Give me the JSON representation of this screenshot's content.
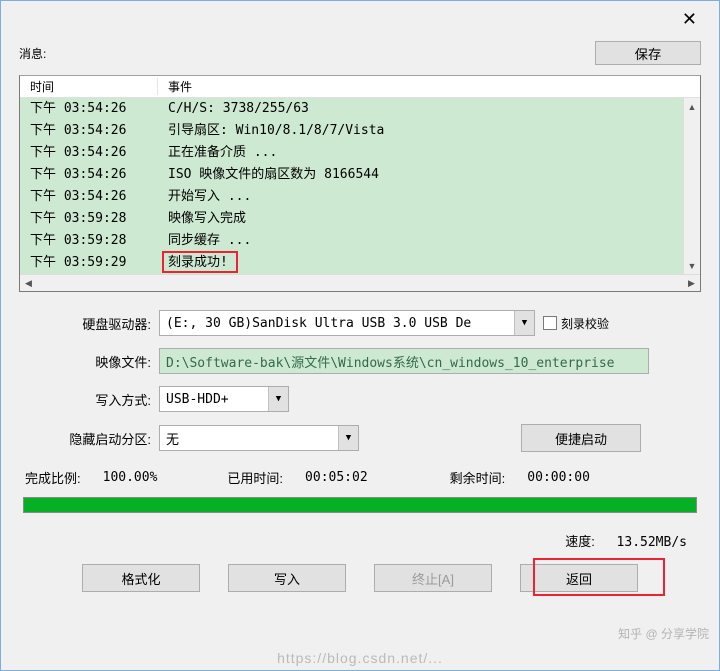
{
  "titlebar": {
    "close": "✕"
  },
  "top": {
    "message_label": "消息:",
    "save_label": "保存"
  },
  "log": {
    "header_time": "时间",
    "header_event": "事件",
    "rows": [
      {
        "time": "下午 03:54:26",
        "event": "C/H/S: 3738/255/63"
      },
      {
        "time": "下午 03:54:26",
        "event": "引导扇区: Win10/8.1/8/7/Vista"
      },
      {
        "time": "下午 03:54:26",
        "event": "正在准备介质 ..."
      },
      {
        "time": "下午 03:54:26",
        "event": "ISO 映像文件的扇区数为 8166544"
      },
      {
        "time": "下午 03:54:26",
        "event": "开始写入 ..."
      },
      {
        "time": "下午 03:59:28",
        "event": "映像写入完成"
      },
      {
        "time": "下午 03:59:28",
        "event": "同步缓存 ..."
      },
      {
        "time": "下午 03:59:29",
        "event": "刻录成功!"
      }
    ]
  },
  "form": {
    "drive_label": "硬盘驱动器:",
    "drive_value": "(E:, 30 GB)SanDisk Ultra USB 3.0 USB De",
    "verify_label": "刻录校验",
    "image_label": "映像文件:",
    "image_value": "D:\\Software-bak\\源文件\\Windows系统\\cn_windows_10_enterprise",
    "method_label": "写入方式:",
    "method_value": "USB-HDD+",
    "hidden_label": "隐藏启动分区:",
    "hidden_value": "无",
    "convenient_label": "便捷启动"
  },
  "progress": {
    "ratio_label": "完成比例:",
    "ratio_value": "100.00%",
    "elapsed_label": "已用时间:",
    "elapsed_value": "00:05:02",
    "remain_label": "剩余时间:",
    "remain_value": "00:00:00",
    "percent": 100
  },
  "speed": {
    "label": "速度:",
    "value": "13.52MB/s"
  },
  "buttons": {
    "format": "格式化",
    "write": "写入",
    "abort": "终止[A]",
    "back": "返回"
  },
  "watermark": {
    "url": "https://blog.csdn.net/...",
    "right": "知乎 @ 分享学院"
  }
}
